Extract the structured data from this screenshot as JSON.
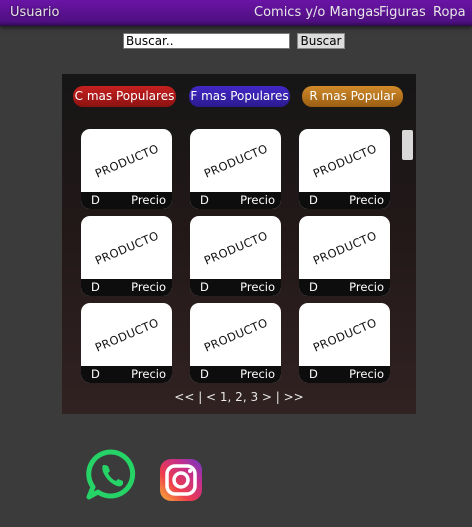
{
  "nav": {
    "brand": "Usuario",
    "links": [
      "Comics y/o Mangas",
      "Figuras",
      "Ropa"
    ]
  },
  "search": {
    "value": "Buscar..",
    "button": "Buscar"
  },
  "filters": [
    "C mas Populares",
    "F mas Populares",
    "R mas Popular"
  ],
  "products": [
    {
      "label": "PRODUCTO",
      "d": "D",
      "price": "Precio"
    },
    {
      "label": "PRODUCTO",
      "d": "D",
      "price": "Precio"
    },
    {
      "label": "PRODUCTO",
      "d": "D",
      "price": "Precio"
    },
    {
      "label": "PRODUCTO",
      "d": "D",
      "price": "Precio"
    },
    {
      "label": "PRODUCTO",
      "d": "D",
      "price": "Precio"
    },
    {
      "label": "PRODUCTO",
      "d": "D",
      "price": "Precio"
    },
    {
      "label": "PRODUCTO",
      "d": "D",
      "price": "Precio"
    },
    {
      "label": "PRODUCTO",
      "d": "D",
      "price": "Precio"
    },
    {
      "label": "PRODUCTO",
      "d": "D",
      "price": "Precio"
    }
  ],
  "pagination": "<< | < 1, 2, 3 > | >>",
  "social": {
    "icons": [
      "whatsapp-icon",
      "instagram-icon"
    ]
  },
  "colors": {
    "nav": "#5a12a0",
    "background": "#3b3b3b",
    "pill_red": "#b81c1c",
    "pill_blue": "#3a24b8",
    "pill_orange": "#c27a20",
    "whatsapp": "#25d366"
  }
}
